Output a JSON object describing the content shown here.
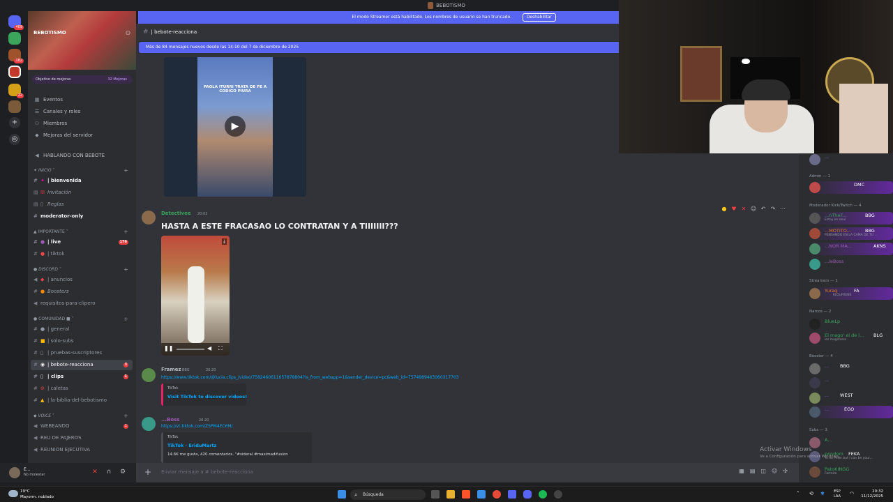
{
  "window": {
    "title": "BEBOTISMO"
  },
  "streamer_banner": {
    "text": "El modo Streamer está habilitado. Los nombres de usuario se han truncado.",
    "button": "Deshabilitar"
  },
  "rail": {
    "home_badge": "409",
    "badge2": "182",
    "badge3": "22"
  },
  "server": {
    "name": "BEBOTISMO",
    "boost_goal": "Objetivo de mejoras",
    "boost_count": "32 Mejoras"
  },
  "sidebar": {
    "items": [
      {
        "label": "Eventos"
      },
      {
        "label": "Canales y roles"
      },
      {
        "label": "Miembros"
      },
      {
        "label": "Mejoras del servidor"
      },
      {
        "label": "HABLANDO CON BEBOTE"
      }
    ],
    "categories": {
      "inicio": "INICIO",
      "importante": "IMPORTANTE",
      "discord": "DISCORD",
      "comunidad": "COMUNIDAD",
      "voice": "VOICE"
    },
    "channels": {
      "bienvenida": "| bienvenida",
      "invitacion": "Invitación",
      "reglas": "Reglas",
      "moderator_only": "moderator-only",
      "live": "| live",
      "live_count": "176",
      "tiktok": "| tiktok",
      "anuncios": "| anuncios",
      "boosters": "Boosters",
      "requisitos": "requisitos-para-clipero",
      "general": "| general",
      "solo_subs": "| solo-subs",
      "pruebas": "| pruebas-suscriptores",
      "bebote": "| bebote-reacciona",
      "bebote_count": "8",
      "clips": "| clips",
      "clips_count": "1",
      "caletas": "| caletas",
      "biblia": "| la-biblia-del-bebotismo",
      "webeando": "WEBEANDO",
      "webeando_count": "1",
      "reu": "REU DE PAJEROS",
      "reunion": "REUNION EJECUTIVA"
    }
  },
  "user": {
    "name": "E...",
    "status": "No molestar"
  },
  "chat": {
    "channel": "| bebote-reacciona",
    "new_messages": "Más de 84 mensajes nuevos desde las 14:10 del 7 de diciembre de 2025",
    "video1_caption": "PAOLA ITURRI TRATA DE PE A CODIGO PIURA",
    "msg1": {
      "author": "Detectivee",
      "time": "20:02",
      "text": "HASTA A ESTE FRACASAO LO CONTRATAN Y A TIIIIIII???"
    },
    "msg2": {
      "author": "Framez",
      "tag": "BBG",
      "time": "20:20",
      "link": "https://www.tiktok.com/@lucia.clips_/video/7582460611657878804?is_from_webapp=1&sender_device=pc&web_id=7574989463060317703",
      "embed_provider": "TikTok",
      "embed_title": "Visit TikTok to discover videos!"
    },
    "msg3": {
      "author": "...Boss",
      "time": "20:20",
      "link": "https://vt.tiktok.com/ZSPM4EC6M/",
      "embed_provider": "TikTok",
      "embed_title": "TikTok · EriduMartz",
      "embed_desc": "14.6K me gusta, 420 comentarios. \"#sideral #maximadifusion"
    },
    "composer_placeholder": "Enviar mensaje a #",
    "composer_channel": "bebote-reacciona"
  },
  "members": {
    "admin_header": "Admin — 1",
    "admin_tag": "DMC",
    "mod_header": "Moderador Kick/Twitch — 4",
    "mods": [
      {
        "name": "...nTheF...",
        "tag": "BBG",
        "status": "Estoy en envi"
      },
      {
        "name": "...MOTITO...",
        "tag": "BBG",
        "status": "PENSANDO EN LA CAMA DE TU ..."
      },
      {
        "name": "...NOR MA...",
        "tag": "AKNS",
        "status": ""
      },
      {
        "name": "...leBoss",
        "tag": "",
        "status": ""
      }
    ],
    "streamers_header": "Streamers — 1",
    "streamer": {
      "name": "Yuraq",
      "tag": "FA",
      "status": "KLOuFRENS"
    },
    "narcos_header": "Narcos — 2",
    "narcos": [
      {
        "name": "BlueLp",
        "tag": "",
        "status": ""
      },
      {
        "name": "El mago' el de l...",
        "tag": "BLG",
        "status": "los magicosss"
      }
    ],
    "booster_header": "Booster — 4",
    "boosters": [
      {
        "name": "...",
        "tag": "BBG"
      },
      {
        "name": "...",
        "tag": ""
      },
      {
        "name": "...",
        "tag": "WEST"
      },
      {
        "name": "...",
        "tag": "EGO"
      }
    ],
    "subs_header": "Subs — 3",
    "subs": [
      {
        "name": "A...",
        "tag": "",
        "status": ""
      },
      {
        "name": "pondom",
        "tag": "FEKA",
        "status": "Yo no Peter but I can be your..."
      },
      {
        "name": "PatoKINGG",
        "tag": "",
        "status": "Fortnite"
      }
    ]
  },
  "watermark": {
    "title": "Activar Windows",
    "sub": "Ve a Configuración para activar Windows."
  },
  "taskbar": {
    "weather_temp": "19°C",
    "weather_cond": "Mayorm. nublado",
    "search": "Búsqueda",
    "lang1": "ESP",
    "lang2": "LAA",
    "time": "20:32",
    "date": "11/12/2025"
  }
}
